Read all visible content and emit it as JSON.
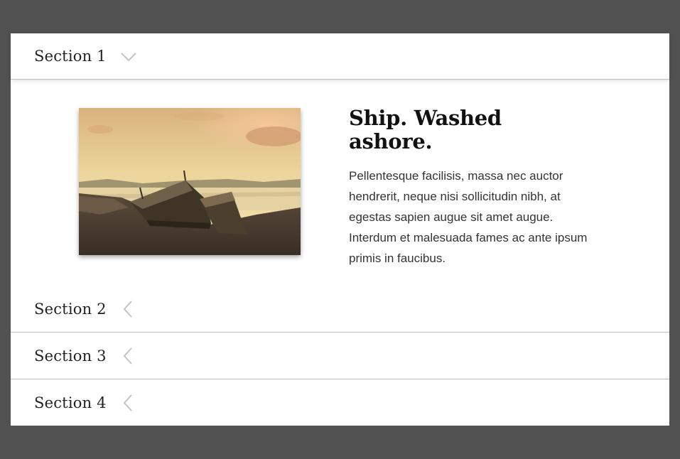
{
  "sections": [
    {
      "label": "Section 1",
      "expanded": true,
      "chevron_icon": "chevron-down-icon",
      "content": {
        "title": "Ship. Washed ashore.",
        "text": "Pellentesque facilisis, massa nec auctor hendrerit, neque nisi sollicitudin nibh, at egestas sapien augue sit amet augue. Interdum et malesuada fames ac ante ipsum primis in faucibus."
      }
    },
    {
      "label": "Section 2",
      "expanded": false,
      "chevron_icon": "chevron-left-icon"
    },
    {
      "label": "Section 3",
      "expanded": false,
      "chevron_icon": "chevron-left-icon"
    },
    {
      "label": "Section 4",
      "expanded": false,
      "chevron_icon": "chevron-left-icon"
    }
  ],
  "colors": {
    "page_background": "#515151",
    "panel_background": "#ffffff",
    "divider": "#bdbdbd",
    "chevron": "#c4c4c4"
  }
}
